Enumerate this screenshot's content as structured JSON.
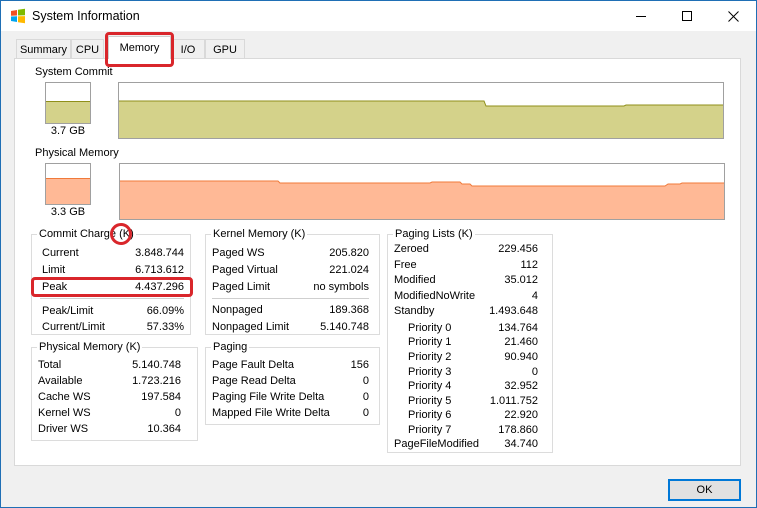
{
  "window": {
    "title": "System Information",
    "icon": "windows-flag-icon",
    "controls": [
      "minimize-icon",
      "maximize-icon",
      "close-icon"
    ]
  },
  "tabs": [
    {
      "label": "Summary",
      "active": false
    },
    {
      "label": "CPU",
      "active": false
    },
    {
      "label": "Memory",
      "active": true
    },
    {
      "label": "I/O",
      "active": false
    },
    {
      "label": "GPU",
      "active": false
    }
  ],
  "system_commit": {
    "label": "System Commit",
    "value": "3.7 GB",
    "level": 0.56,
    "fill_color": "#d4d28a",
    "line_color": "#8f8f1a"
  },
  "physical_memory_graph": {
    "label": "Physical Memory",
    "value": "3.3 GB",
    "level": 0.66,
    "fill_color": "#ffb996",
    "line_color": "#f07a3a"
  },
  "commit_charge": {
    "title": "Commit Charge (K)",
    "rows": [
      {
        "key": "Current",
        "value": "3.848.744"
      },
      {
        "key": "Limit",
        "value": "6.713.612"
      },
      {
        "key": "Peak",
        "value": "4.437.296"
      },
      {
        "key": "Peak/Limit",
        "value": "66.09%"
      },
      {
        "key": "Current/Limit",
        "value": "57.33%"
      }
    ]
  },
  "physical_memory": {
    "title": "Physical Memory (K)",
    "rows": [
      {
        "key": "Total",
        "value": "5.140.748"
      },
      {
        "key": "Available",
        "value": "1.723.216"
      },
      {
        "key": "Cache WS",
        "value": "197.584"
      },
      {
        "key": "Kernel WS",
        "value": "0"
      },
      {
        "key": "Driver WS",
        "value": "10.364"
      }
    ]
  },
  "kernel_memory": {
    "title": "Kernel Memory (K)",
    "rows": [
      {
        "key": "Paged WS",
        "value": "205.820"
      },
      {
        "key": "Paged Virtual",
        "value": "221.024"
      },
      {
        "key": "Paged Limit",
        "value": "no symbols"
      },
      {
        "key": "Nonpaged",
        "value": "189.368"
      },
      {
        "key": "Nonpaged Limit",
        "value": "5.140.748"
      }
    ]
  },
  "paging": {
    "title": "Paging",
    "rows": [
      {
        "key": "Page Fault Delta",
        "value": "156"
      },
      {
        "key": "Page Read Delta",
        "value": "0"
      },
      {
        "key": "Paging File Write Delta",
        "value": "0"
      },
      {
        "key": "Mapped File Write Delta",
        "value": "0"
      }
    ]
  },
  "paging_lists": {
    "title": "Paging Lists (K)",
    "rows": [
      {
        "key": "Zeroed",
        "value": "229.456"
      },
      {
        "key": "Free",
        "value": "112"
      },
      {
        "key": "Modified",
        "value": "35.012"
      },
      {
        "key": "ModifiedNoWrite",
        "value": "4"
      },
      {
        "key": "Standby",
        "value": "1.493.648"
      },
      {
        "key": "Priority 0",
        "value": "134.764"
      },
      {
        "key": "Priority 1",
        "value": "21.460"
      },
      {
        "key": "Priority 2",
        "value": "90.940"
      },
      {
        "key": "Priority 3",
        "value": "0"
      },
      {
        "key": "Priority 4",
        "value": "32.952"
      },
      {
        "key": "Priority 5",
        "value": "1.011.752"
      },
      {
        "key": "Priority 6",
        "value": "22.920"
      },
      {
        "key": "Priority 7",
        "value": "178.860"
      },
      {
        "key": "PageFileModified",
        "value": "34.740"
      }
    ]
  },
  "buttons": {
    "ok": "OK"
  },
  "highlight_color": "#d9262b"
}
